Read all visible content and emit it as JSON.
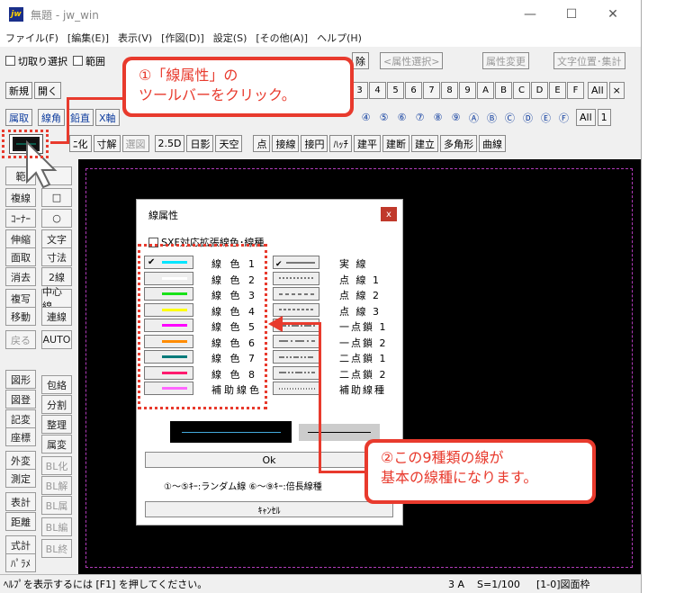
{
  "window": {
    "title": "無題 - jw_win",
    "icon": "jw",
    "controls": [
      "minimize-icon",
      "maximize-icon",
      "close-icon"
    ]
  },
  "menu": [
    "ファイル(F)",
    "[編集(E)]",
    "表示(V)",
    "[作図(D)]",
    "設定(S)",
    "[その他(A)]",
    "ヘルプ(H)"
  ],
  "toolbar1": {
    "chk1": "切取り選択",
    "chk2": "範囲",
    "remove": "除",
    "attr_select": "<属性選択>",
    "attr_change": "属性変更",
    "text_pos": "文字位置･集計"
  },
  "toolbar2": {
    "new": "新規",
    "open": "開く",
    "save_partial": "",
    "layer_nums": [
      "3",
      "4",
      "5",
      "6",
      "7",
      "8",
      "9",
      "A",
      "B",
      "C",
      "D",
      "E",
      "F"
    ],
    "all": "All",
    "x": "×"
  },
  "toolbar3": {
    "attr": "属取",
    "line_corner": "線角",
    "vertical": "鉛直",
    "x_axis": "X軸",
    "circle_nums": [
      "④",
      "⑤",
      "⑥",
      "⑦",
      "⑧",
      "⑨",
      "Ⓐ",
      "Ⓑ",
      "Ⓒ",
      "Ⓓ",
      "Ⓔ",
      "Ⓕ"
    ],
    "all": "All",
    "one": "1"
  },
  "toolbar4": {
    "buttons": [
      "ﾆ化",
      "寸解",
      "選図",
      "2.5D",
      "日影",
      "天空",
      "点",
      "接線",
      "接円",
      "ﾊｯﾁ",
      "建平",
      "建断",
      "建立",
      "多角形",
      "曲線"
    ]
  },
  "left_toolbar": [
    [
      "範",
      ""
    ],
    [
      "複線",
      "□"
    ],
    [
      "ｺｰﾅｰ",
      "○"
    ],
    [
      "伸縮",
      "文字"
    ],
    [
      "面取",
      "寸法"
    ],
    [
      "消去",
      "2線"
    ],
    [
      "複写",
      "中心線"
    ],
    [
      "移動",
      "連線"
    ],
    [
      "戻る",
      "AUTO"
    ],
    [
      "図形",
      "包絡"
    ],
    [
      "図登",
      "分割"
    ],
    [
      "記変",
      "整理"
    ],
    [
      "座標",
      "属変"
    ],
    [
      "外変",
      "BL化"
    ],
    [
      "測定",
      "BL解"
    ],
    [
      "表計",
      "BL属"
    ],
    [
      "距離",
      "BL編"
    ],
    [
      "式計",
      "BL終"
    ],
    [
      "ﾊﾟﾗﾒ",
      ""
    ]
  ],
  "dialog": {
    "title": "線属性",
    "close": "x",
    "sxf_checkbox": "SXF対応拡張線色･線種",
    "colors": [
      {
        "label": "線 色 1",
        "color": "#00e5ff",
        "checked": true
      },
      {
        "label": "線 色 2",
        "color": "#ffffff",
        "checked": false
      },
      {
        "label": "線 色 3",
        "color": "#19e219",
        "checked": false
      },
      {
        "label": "線 色 4",
        "color": "#ffff00",
        "checked": false
      },
      {
        "label": "線 色 5",
        "color": "#ff00ff",
        "checked": false
      },
      {
        "label": "線 色 6",
        "color": "#ff8c00",
        "checked": false
      },
      {
        "label": "線 色 7",
        "color": "#007a7a",
        "checked": false
      },
      {
        "label": "線 色 8",
        "color": "#ff1a6e",
        "checked": false
      },
      {
        "label": "補助線色",
        "color": "#ff66ff",
        "checked": false
      }
    ],
    "types": [
      {
        "label": "実 線",
        "pattern": "solid",
        "checked": true
      },
      {
        "label": "点 線 1",
        "pattern": "dot1",
        "checked": false
      },
      {
        "label": "点 線 2",
        "pattern": "dot2",
        "checked": false
      },
      {
        "label": "点 線 3",
        "pattern": "dot3",
        "checked": false
      },
      {
        "label": "一点鎖 1",
        "pattern": "chain1",
        "checked": false
      },
      {
        "label": "一点鎖 2",
        "pattern": "chain2",
        "checked": false
      },
      {
        "label": "二点鎖 1",
        "pattern": "dchain1",
        "checked": false
      },
      {
        "label": "二点鎖 2",
        "pattern": "dchain2",
        "checked": false
      },
      {
        "label": "補助線種",
        "pattern": "aux",
        "checked": false
      }
    ],
    "ok": "Ok",
    "hint": "①～⑤ｷｰ:ランダム線  ⑥～⑨ｷｰ:倍長線種",
    "cancel": "ｷｬﾝｾﾙ"
  },
  "callout1": {
    "line1": "①「線属性」の",
    "line2": "ツールバーをクリック。"
  },
  "callout2": {
    "line1": "②この9種類の線が",
    "line2": "基本の線種になります。"
  },
  "status": {
    "help": "ﾍﾙﾌﾟを表示するには [F1] を押してください。",
    "scale_a": "3 A",
    "scale": "S=1/100",
    "layer": "[1-0]図面枠"
  },
  "accent": "#e83a2d"
}
